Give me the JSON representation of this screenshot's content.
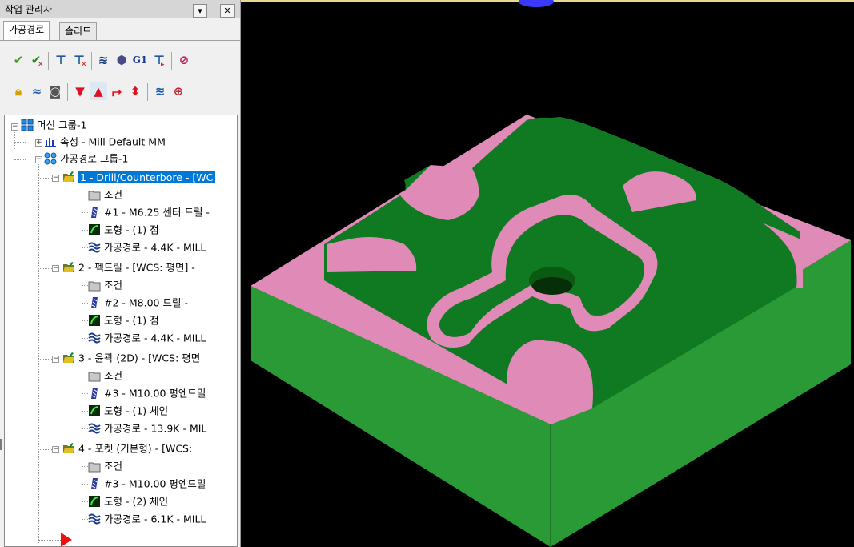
{
  "panel": {
    "title": "작업 관리자",
    "pin_symbol": "▾",
    "close_symbol": "✕",
    "tabs": [
      "가공경로",
      "솔리드"
    ],
    "toolbar1_text_icon": "G1"
  },
  "tree": {
    "machine_group": "머신 그룹-1",
    "properties": "속성 - Mill Default MM",
    "toolpath_group": "가공경로 그룹-1",
    "operations": [
      {
        "label": "1 - Drill/Counterbore - [WC",
        "selected": true,
        "children": [
          "조건",
          "#1 - M6.25 센터 드릴 -",
          "도형 - (1) 점",
          "가공경로 - 4.4K - MILL"
        ]
      },
      {
        "label": "2 - 펙드릴 - [WCS: 평면] -",
        "selected": false,
        "children": [
          "조건",
          "#2 - M8.00 드릴 -",
          "도형 - (1) 점",
          "가공경로 - 4.4K - MILL"
        ]
      },
      {
        "label": "3 - 윤곽 (2D) - [WCS: 평면",
        "selected": false,
        "children": [
          "조건",
          "#3 - M10.00 평엔드밀",
          "도형 - (1) 체인",
          "가공경로 - 13.9K - MIL"
        ]
      },
      {
        "label": "4 - 포켓 (기본형) - [WCS: ",
        "selected": false,
        "children": [
          "조건",
          "#3 - M10.00 평엔드밀",
          "도형 - (2) 체인",
          "가공경로 - 6.1K - MILL"
        ]
      }
    ]
  },
  "colors": {
    "part_top": "#0f7a22",
    "part_side": "#2e9a3a",
    "cut_wall": "#e08ab8",
    "selection": "#0078d7",
    "viewport_bg": "#000000"
  }
}
